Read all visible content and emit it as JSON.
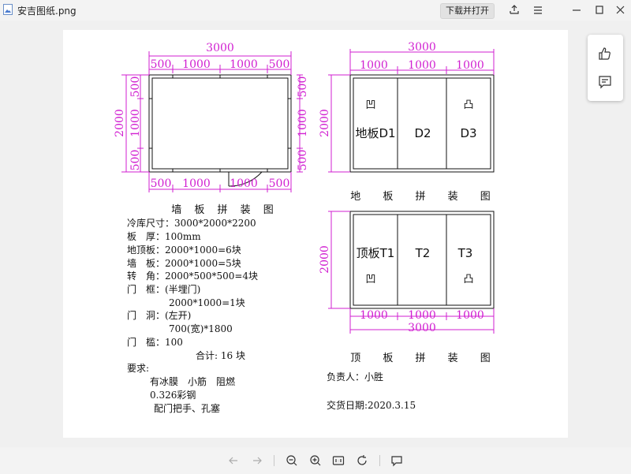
{
  "window": {
    "file_name": "安吉图纸.png",
    "open_button_label": "下载并打开",
    "icons": [
      "share-icon",
      "menu-icon",
      "minimize-icon",
      "maximize-icon",
      "close-icon"
    ]
  },
  "side_panel": {
    "icons": [
      "thumbs-up-icon",
      "comment-icon"
    ]
  },
  "toolbar": {
    "icons": [
      "prev-arrow-icon",
      "next-arrow-icon",
      "zoom-out-icon",
      "zoom-in-icon",
      "actual-size-icon",
      "rotate-icon",
      "comment-icon"
    ]
  },
  "colors": {
    "dimension": "#d11fd1",
    "lines": "#111111"
  },
  "drawing": {
    "wall": {
      "top_total": "3000",
      "top_segs": [
        "500",
        "1000",
        "1000",
        "500"
      ],
      "bottom_segs": [
        "500",
        "1000",
        "1000",
        "500"
      ],
      "left_total": "2000",
      "left_segs": [
        "500",
        "1000",
        "500"
      ],
      "right_segs": [
        "500",
        "1000",
        "500"
      ],
      "caption": "墙 板 拼 装 图"
    },
    "floor": {
      "top_total": "3000",
      "top_segs": [
        "1000",
        "1000",
        "1000"
      ],
      "left_total": "2000",
      "cells": [
        "地板D1",
        "D2",
        "D3"
      ],
      "symbols": [
        "凹",
        "凸"
      ],
      "caption": "地 板 拼 装 图"
    },
    "roof": {
      "bottom_total": "3000",
      "bottom_segs": [
        "1000",
        "1000",
        "1000"
      ],
      "left_total": "2000",
      "cells": [
        "顶板T1",
        "T2",
        "T3"
      ],
      "symbols": [
        "凹",
        "凸"
      ],
      "caption": "顶 板 拼 装 图"
    },
    "specs": [
      "冷库尺寸：3000*2000*2200",
      "板　厚：100mm",
      "地顶板：2000*1000=6块",
      "墙　板：2000*1000=5块",
      "转　角：2000*500*500=4块",
      "门　框：(半埋门)",
      "2000*1000=1块",
      "门　洞：(左开)",
      "700(宽)*1800",
      "门　槛：100",
      "合计: 16 块",
      "要求:",
      "有冰膜　小筋　阻燃",
      "0.326彩钢",
      "配门把手、孔塞"
    ],
    "responsible": "负责人：小胜",
    "delivery": "交货日期:2020.3.15"
  }
}
